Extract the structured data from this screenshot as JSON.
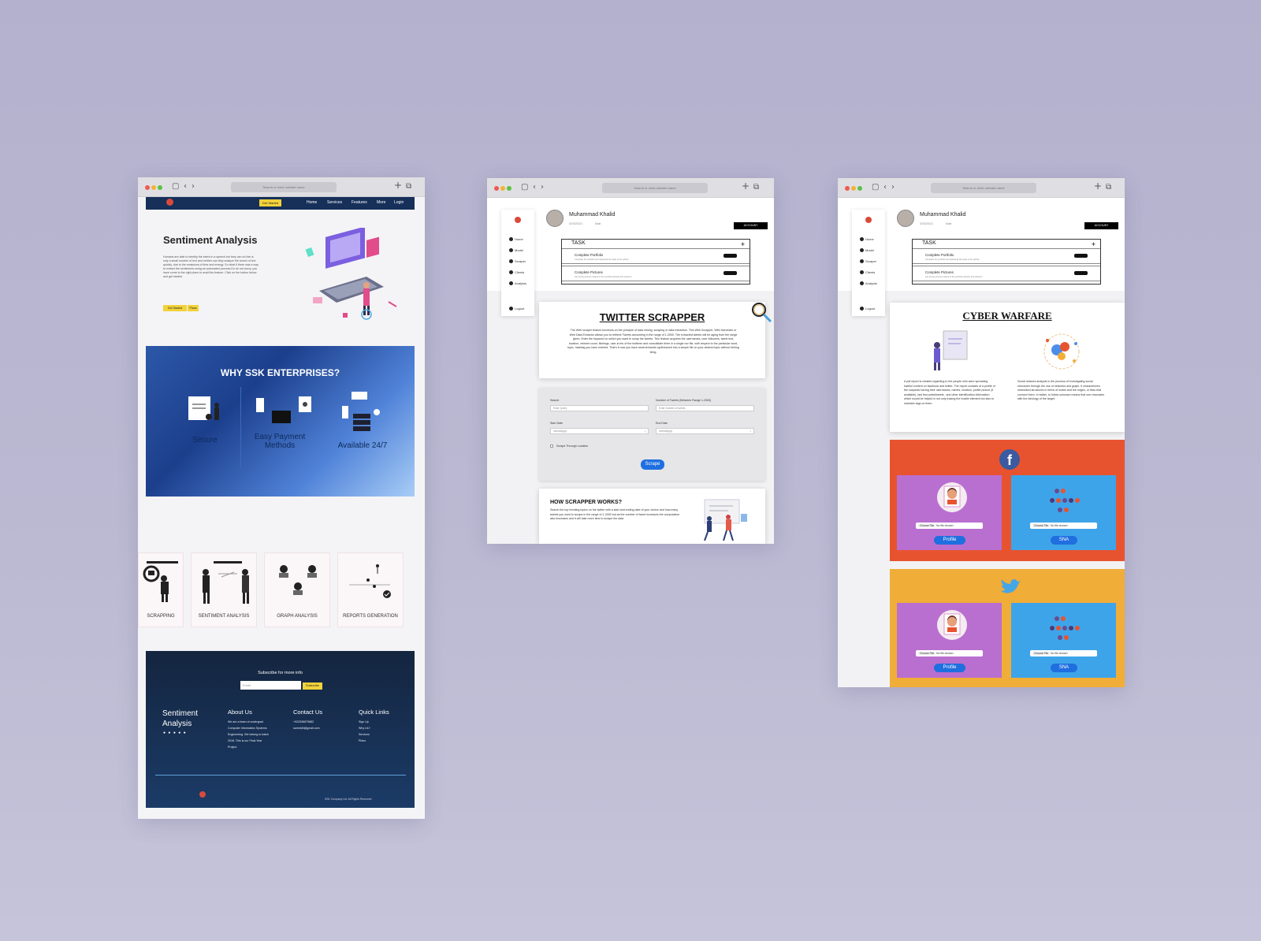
{
  "left_site": {
    "chrome": {
      "url_placeholder": "Search or enter website name"
    },
    "nav": {
      "cta": "Get Started",
      "links": [
        "Home",
        "Services",
        "Features",
        "More",
        "Login"
      ]
    },
    "hero": {
      "title": "Sentiment Analysis",
      "text": "Humans are able to identify the intent in a speech but they can do this is only a small number of text and neither can they analyze the bunch of text quickly. due to the emissions of time and energy. So what if there was a way to extract the sentiments using an automated process.Do do not worry, you have come to the right place to avail this feature. Click on the button below and get started",
      "btn_primary": "Get Started",
      "btn_secondary": "Plans"
    },
    "why": {
      "title": "WHY SSK ENTERPRISES?",
      "features": [
        "Secure",
        "Easy Payment Methods",
        "Available 24/7"
      ]
    },
    "services": [
      "SCRAPPING",
      "SENTIMENT ANALYSIS",
      "GRAPH ANALYSIS",
      "REPORTS GENERATION"
    ],
    "footer": {
      "subscribe_title": "Subscribe for more info",
      "email_placeholder": "Email",
      "subscribe_btn": "Subscribe",
      "brand": "Sentiment Analysis",
      "about_title": "About Us",
      "about_text": "We are a team of undergrad Computer Information Systems Engineering. We belong to batch 2018. This is our Final Year Project.",
      "contact_title": "Contact Us",
      "contact_phone": "+923336879882",
      "contact_email": "sameldh@gmail.com",
      "quick_title": "Quick Links",
      "quick_links": [
        "Sign Up",
        "Why Us?",
        "Services",
        "Plans"
      ],
      "copyright": "SSK Company Ltd. All Rights Reserved"
    }
  },
  "dashboard": {
    "user_name": "Muhammad Khalid",
    "user_sub": "02/02/2021",
    "user_role": "Male",
    "account_btn": "ACCOUNT",
    "sidebar": [
      "Home",
      "Model",
      "Scraper",
      "Clients",
      "Analysis",
      "Logout"
    ],
    "task": {
      "title": "TASK",
      "items": [
        {
          "title": "Complete Portfolio",
          "desc": "Complete the portfolio and upload all the tasks to the github"
        },
        {
          "title": "Complete Pictures",
          "desc": "Get all the pictures related to the portfolio website and upload it"
        }
      ]
    }
  },
  "middle": {
    "title": "TWITTER SCRAPPER",
    "description": "The Web scraper feature functions on the principle of data mining, scraping or data extraction. This Web Scrapper, Web Harvester or Web Data Extractor allows you to retrieve Tweets amounting in the range of 1-2000. The extracted tweets will be aging from the range given. Enter the keyword on which you want to scrap the tweets. This feature acquires the usernames, user-followers, tweet text, location, retweet count, likelings, user-id etc of the twitterer and consolidate them in a single csv file, with respect to the particular word, topic, hashtag you have entered. That's it now you have several tweets synthesized into a simple file on your desired topic without feeling tiring.",
    "form": {
      "search_label": "Search",
      "search_placeholder": "Enter Query",
      "num_label": "Number of Tweets (Between Range 1-2000)",
      "num_placeholder": "Enter Number of tweets",
      "start_label": "Start Date",
      "end_label": "End Date",
      "date_placeholder": "mm/dd/yyyy",
      "checkbox_label": "Scrape Through Location",
      "button": "Scrape"
    },
    "how": {
      "title": "HOW SCRAPPER WORKS?",
      "text": "Search the top trending topics on the twitter with a start and ending date of your choice and how many tweets you want to scrape in the range of 1-2000 but as the number of tweet increases the computation also increases and it will take more time to scrape the data"
    }
  },
  "right": {
    "title": "CYBER WARFARE",
    "left_text": "A pdf report is created regarding to the people who were spreading hateful content on facebook and twitter. The report consists of a profile of the suspects having their usernames, names, location, profile picture (if available), last few posts/tweets , and other identification information which would be helpful in not only tracing the hostile element but also to maintain tags on them.",
    "right_text": "Social network analysis is the process of investigating social structures through the use of networks and graph. It characterizes networked structures in terms of nodes and the edges, or links that connect them. In twitter, to follow unknown means that one resonates with the ideology of the target.",
    "panels": [
      {
        "icon": "f",
        "name": "facebook-panel",
        "profile_btn": "Profile",
        "sna_btn": "SNA",
        "choose": "Choose File",
        "nofile": "No file chosen"
      },
      {
        "icon": "twitter",
        "name": "twitter-panel",
        "profile_btn": "Profile",
        "sna_btn": "SNA",
        "choose": "Choose File",
        "nofile": "No file chosen"
      }
    ],
    "colors": {
      "facebook_bg": "#e8532f",
      "twitter_bg": "#f0ad38",
      "profile_card": "#b96fd0",
      "sna_card": "#3ea4ea",
      "accent_blue": "#1f6fe0"
    }
  }
}
